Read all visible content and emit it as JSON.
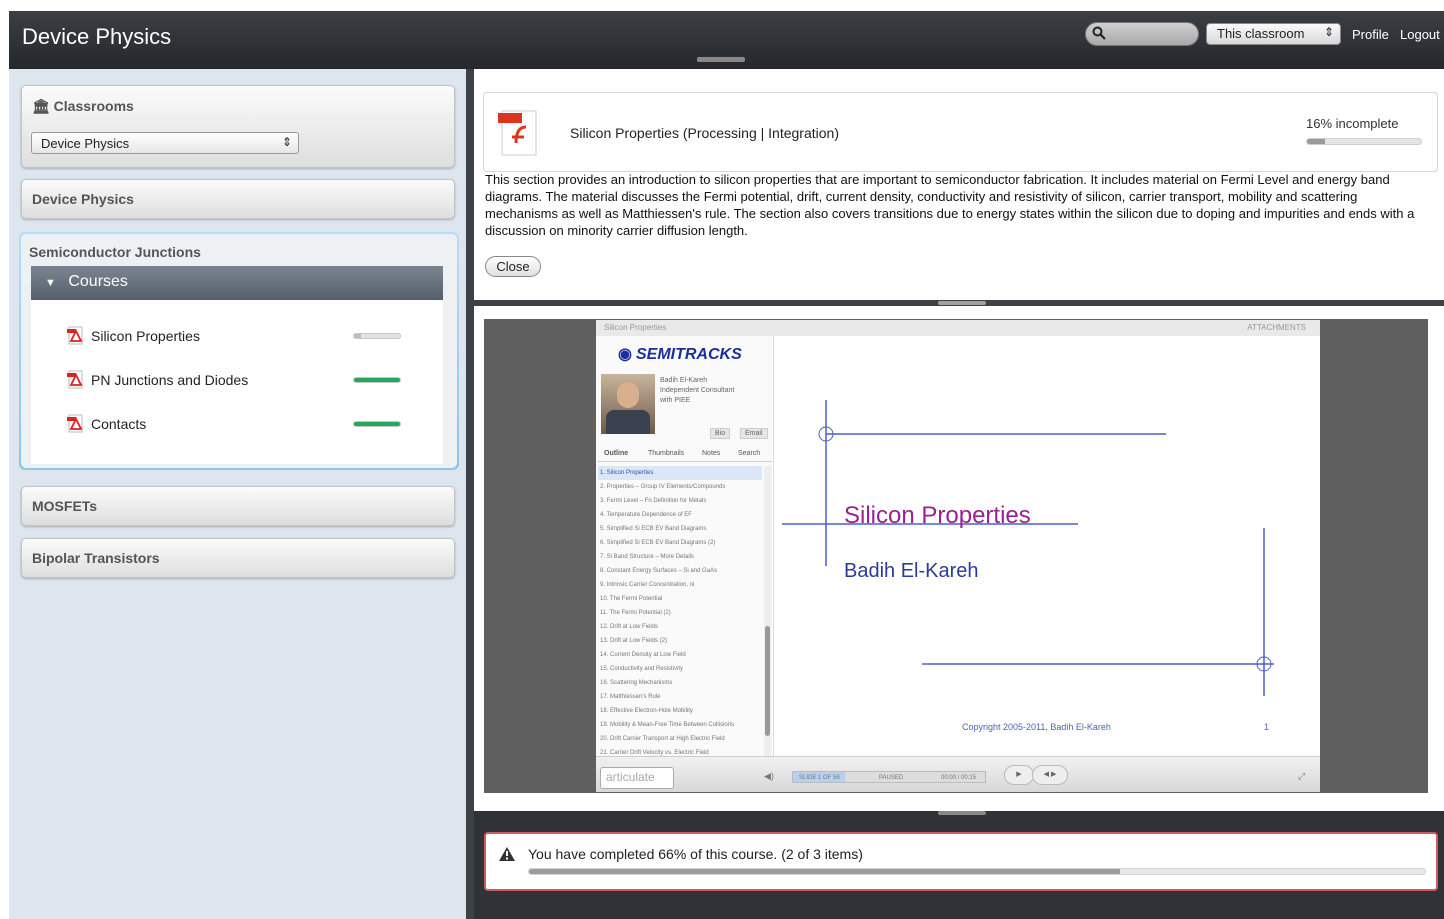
{
  "app": {
    "title": "Device Physics"
  },
  "topbar": {
    "search_placeholder": "",
    "scope_select": "This classroom",
    "profile_link": "Profile",
    "logout_link": "Logout"
  },
  "sidebar": {
    "classrooms_heading": "Classrooms",
    "classroom_select": "Device Physics",
    "sections": {
      "device_physics": "Device Physics",
      "semiconductor_junctions": "Semiconductor Junctions",
      "mosfets": "MOSFETs",
      "bipolar_transistors": "Bipolar Transistors"
    },
    "courses_label": "Courses",
    "courses": [
      {
        "label": "Silicon Properties",
        "progress": 0.16
      },
      {
        "label": "PN Junctions and Diodes",
        "progress": 1.0
      },
      {
        "label": "Contacts",
        "progress": 1.0
      }
    ]
  },
  "module": {
    "title": "Silicon Properties (Processing | Integration)",
    "incomplete_text": "16% incomplete",
    "incomplete_progress": 0.16,
    "description": "This section provides an introduction to silicon properties that are important to semiconductor fabrication.  It includes material on Fermi Level and energy band diagrams.  The material discusses the Fermi potential, drift, current density, conductivity and resistivity of silicon, carrier transport, mobility and scattering mechanisms as well as Matthiessen's rule.  The section also covers transitions due to energy states within the silicon due to doping and impurities and ends with a discussion on minority carrier diffusion length.",
    "close_button": "Close"
  },
  "player": {
    "top_title": "Silicon Properties",
    "top_right": "ATTACHMENTS",
    "logo": "SEMITRACKS",
    "presenter_name": "Badih El-Kareh",
    "presenter_line2": "Independent Consultant",
    "presenter_line3": "with PIEE",
    "bio_button": "Bio",
    "email_button": "Email",
    "tabs": [
      "Outline",
      "Thumbnails",
      "Notes",
      "Search"
    ],
    "outline": [
      "1. Silicon Properties",
      "2. Properties – Group IV Elements/Compounds",
      "3. Fermi Level – Fn Definition for Metals",
      "4. Temperature Dependence of EF",
      "5. Simplified Si ECB EV Band Diagrams",
      "6. Simplified Si ECB EV Band Diagrams (2)",
      "7. Si Band Structure – More Details",
      "8. Constant Energy Surfaces – Si and GaAs",
      "9. Intrinsic Carrier Concentration, ni",
      "10. The Fermi Potential",
      "11. The Fermi Potential (2)",
      "12. Drift at Low Fields",
      "13. Drift at Low Fields (2)",
      "14. Current Density at Low Field",
      "15. Conductivity and Resistivity",
      "16. Scattering Mechanisms",
      "17. Matthiessen's Rule",
      "18. Effective Electron-Hole Mobility",
      "19. Mobility & Mean-Free Time Between Collisions",
      "20. Drift Carrier Transport at High Electric Field",
      "21. Carrier Drift Velocity vs. Electric Field"
    ],
    "slide_title": "Silicon Properties",
    "slide_author": "Badih El-Kareh",
    "slide_copyright": "Copyright 2005-2011, Badih El-Kareh",
    "slide_page": "1",
    "articulate_logo": "articulate",
    "slide_counter": "SLIDE 1 OF 58",
    "status": "PAUSED",
    "time": "00:00 / 00:15"
  },
  "completion": {
    "text": "You have completed 66% of this course. (2 of 3 items)",
    "progress": 0.66
  },
  "colors": {
    "topbar": "#2b2e32",
    "accent_green": "#23a860",
    "warning_border": "#d35a5a",
    "slide_title": "#9a2190",
    "slide_author": "#2a3c99"
  }
}
